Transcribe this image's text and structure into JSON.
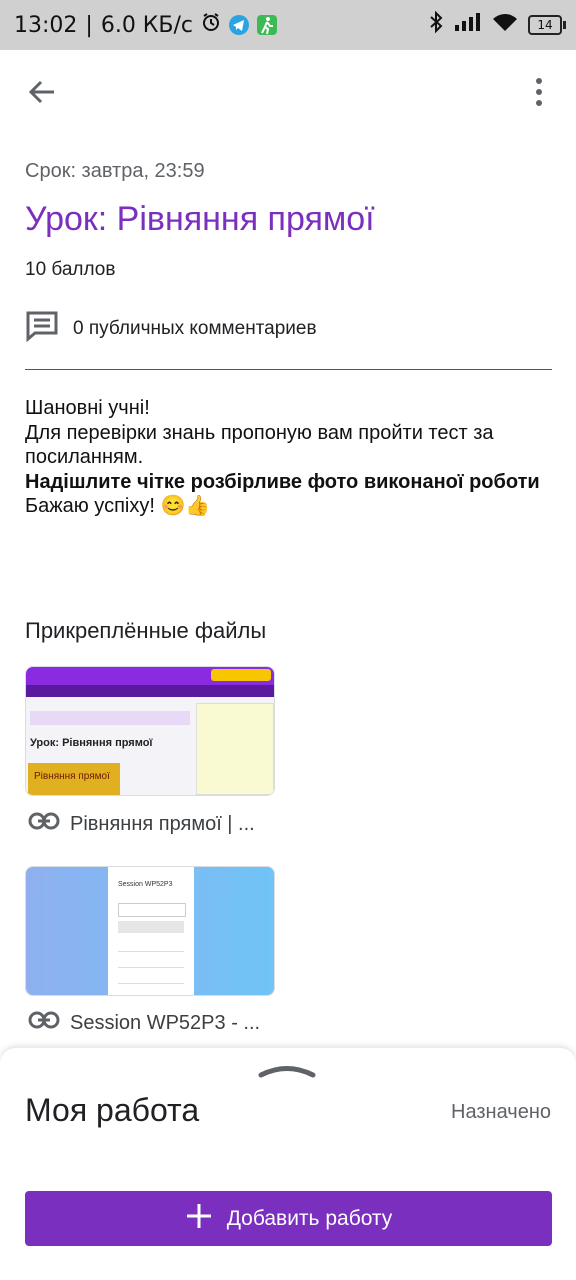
{
  "status_bar": {
    "time": "13:02",
    "separator": "|",
    "speed": "6.0 КБ/с",
    "battery": "14"
  },
  "assignment": {
    "due": "Срок: завтра, 23:59",
    "title": "Урок: Рівняння прямої",
    "points": "10 баллов",
    "comments": "0 публичных комментариев",
    "description": {
      "line1": "Шановні учні!",
      "line2": "Для перевірки знань пропоную вам пройти тест за посиланням.",
      "line3_bold": "Надішлите чітке розбірливе фото  виконаної роботи",
      "line4": "Бажаю успіху! 😊👍"
    }
  },
  "attachments": {
    "heading": "Прикреплённые файлы",
    "items": [
      {
        "label": "Рівняння прямої | ...",
        "thumb_title": "Урок: Рівняння прямої",
        "thumb_banner": "Рівняння прямої"
      },
      {
        "label": "Session WP52P3 - ...",
        "thumb_title": "Session WP52P3"
      }
    ]
  },
  "my_work": {
    "title": "Моя работа",
    "status": "Назначено",
    "add_button": "Добавить работу"
  },
  "colors": {
    "accent": "#7b2fbe",
    "status_bar": "#d0d0d0"
  },
  "icons": [
    "back-arrow-icon",
    "more-vert-icon",
    "comment-icon",
    "link-icon",
    "plus-icon",
    "chevron-up-icon",
    "bluetooth-icon",
    "signal-icon",
    "wifi-icon",
    "battery-icon",
    "alarm-icon",
    "telegram-icon",
    "walk-icon"
  ]
}
